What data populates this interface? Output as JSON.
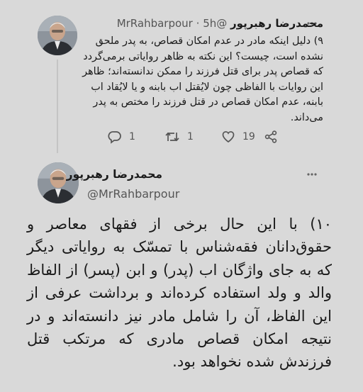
{
  "tweet1": {
    "display_name": "محمدرضا رهبرپور",
    "handle": "@MrRahbarpour",
    "separator": "·",
    "time": "5h",
    "text": "۹) دلیل اینکه مادر در عدم امکان قصاص، به پدر ملحق نشده است، چیست؟ این نکته به ظاهر روایاتی برمی‌گردد که قصاص پدر برای قتل فرزند را ممکن ندانسته‌اند؛ ظاهر این روایات با الفاظی چون لایُقتل اب بابنه و یا لایُقاد اب بابنه، عدم امکان قصاص در قتل فرزند را مختص به پدر می‌داند.",
    "reply_count": "1",
    "retweet_count": "1",
    "like_count": "19",
    "icons": [
      "more-icon",
      "reply-icon",
      "retweet-icon",
      "like-icon",
      "share-icon"
    ]
  },
  "tweet2": {
    "display_name": "محمدرضا رهبرپور",
    "handle": "@MrRahbarpour",
    "text": "۱۰) با این حال برخی از فقهای معاصر و حقوق‌دانان فقه‌شناس با تمسّک به روایاتی دیگر که به جای واژگان اب (پدر) و ابن (پسر) از الفاظ والد و ولد استفاده کرده‌اند و برداشت عرفی از این الفاظ، آن را شامل مادر نیز دانسته‌اند و در نتیجه امکان قصاص مادری که مرتکب قتل فرزندش شده نخواهد بود.",
    "icons": [
      "more-icon"
    ]
  }
}
